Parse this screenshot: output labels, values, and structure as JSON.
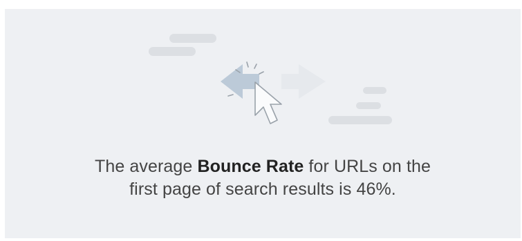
{
  "colors": {
    "card_background": "#eef0f3",
    "decor_bars": "#dcdfe3",
    "arrow_primary": "#bccad8",
    "arrow_faded": "#e6e9ed",
    "cursor_fill": "#fafbfc",
    "cursor_outline": "#9aa2aa",
    "text": "#444444"
  },
  "illustration": {
    "icon": "bounce-cursor-arrows-icon"
  },
  "stat": {
    "prefix": "The average ",
    "highlight": "Bounce Rate",
    "suffix_line1": " for URLs on the",
    "line2": "first page of search results is 46%."
  }
}
